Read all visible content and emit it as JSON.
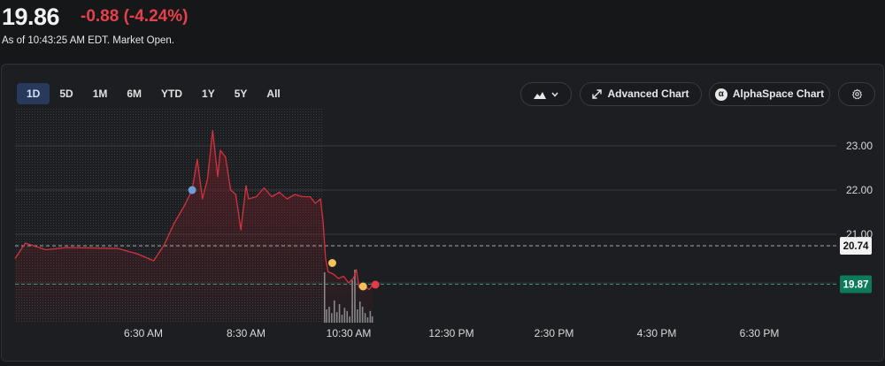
{
  "quote": {
    "price": "19.86",
    "change": "-0.88 (-4.24%)",
    "as_of": "As of 10:43:25 AM EDT. Market Open."
  },
  "toolbar": {
    "ranges": [
      "1D",
      "5D",
      "1M",
      "6M",
      "YTD",
      "1Y",
      "5Y",
      "All"
    ],
    "active_range": "1D",
    "advanced_chart_label": "Advanced Chart",
    "alphaspace_label": "AlphaSpace Chart"
  },
  "colors": {
    "down": "#e5404b",
    "line": "#d2323f",
    "current_badge": "#0d7a5c",
    "active_range_bg": "#283a5c"
  },
  "chart_data": {
    "type": "line",
    "x_ticks": [
      "6:30 AM",
      "8:30 AM",
      "10:30 AM",
      "12:30 PM",
      "2:30 PM",
      "4:30 PM",
      "6:30 PM"
    ],
    "y_ticks": [
      23.0,
      22.0,
      21.0
    ],
    "ylim": [
      19.0,
      23.8
    ],
    "reference_lines": [
      {
        "label": "20.74",
        "value": 20.74,
        "style": "dashed"
      },
      {
        "label": "19.87",
        "value": 19.87,
        "style": "dashed-green"
      }
    ],
    "series": [
      {
        "points": [
          [
            4.0,
            20.45
          ],
          [
            4.2,
            20.8
          ],
          [
            4.6,
            20.65
          ],
          [
            5.0,
            20.7
          ],
          [
            5.5,
            20.69
          ],
          [
            6.0,
            20.68
          ],
          [
            6.4,
            20.55
          ],
          [
            6.7,
            20.4
          ],
          [
            6.9,
            20.75
          ],
          [
            7.1,
            21.25
          ],
          [
            7.3,
            21.65
          ],
          [
            7.45,
            22.0
          ],
          [
            7.55,
            22.7
          ],
          [
            7.65,
            21.8
          ],
          [
            7.75,
            22.25
          ],
          [
            7.85,
            23.35
          ],
          [
            7.95,
            22.3
          ],
          [
            8.0,
            22.9
          ],
          [
            8.1,
            22.75
          ],
          [
            8.2,
            22.0
          ],
          [
            8.3,
            21.9
          ],
          [
            8.4,
            21.1
          ],
          [
            8.5,
            22.1
          ],
          [
            8.55,
            21.8
          ],
          [
            8.7,
            21.85
          ],
          [
            8.85,
            22.05
          ],
          [
            9.0,
            21.85
          ],
          [
            9.15,
            21.95
          ],
          [
            9.3,
            21.8
          ],
          [
            9.45,
            21.9
          ],
          [
            9.6,
            21.85
          ],
          [
            9.75,
            21.85
          ],
          [
            9.85,
            21.7
          ],
          [
            9.95,
            21.8
          ],
          [
            10.0,
            21.3
          ],
          [
            10.05,
            20.45
          ],
          [
            10.1,
            20.15
          ],
          [
            10.2,
            20.1
          ],
          [
            10.3,
            20.0
          ],
          [
            10.4,
            20.05
          ],
          [
            10.5,
            19.9
          ],
          [
            10.6,
            20.02
          ],
          [
            10.65,
            20.2
          ],
          [
            10.7,
            19.8
          ],
          [
            10.8,
            19.83
          ],
          [
            10.9,
            19.75
          ],
          [
            10.97,
            19.86
          ]
        ]
      }
    ],
    "markers": [
      {
        "x": 7.45,
        "y": 22.0,
        "color": "#6aa0d6"
      },
      {
        "x": 10.18,
        "y": 20.35,
        "color": "#f3c05a"
      },
      {
        "x": 10.78,
        "y": 19.82,
        "color": "#f3c05a"
      },
      {
        "x": 11.02,
        "y": 19.86,
        "color": "#e53b48"
      }
    ],
    "volume": [
      [
        10.03,
        0.95
      ],
      [
        10.07,
        0.25
      ],
      [
        10.12,
        0.3
      ],
      [
        10.17,
        0.18
      ],
      [
        10.22,
        0.42
      ],
      [
        10.27,
        0.2
      ],
      [
        10.32,
        0.35
      ],
      [
        10.37,
        0.15
      ],
      [
        10.42,
        0.28
      ],
      [
        10.47,
        0.22
      ],
      [
        10.52,
        0.12
      ],
      [
        10.57,
        0.8
      ],
      [
        10.62,
        1.0
      ],
      [
        10.67,
        0.25
      ],
      [
        10.72,
        0.4
      ],
      [
        10.77,
        0.3
      ],
      [
        10.82,
        0.18
      ],
      [
        10.87,
        0.1
      ],
      [
        10.92,
        0.22
      ],
      [
        10.96,
        0.12
      ]
    ],
    "grid": true,
    "premarket_end": 10.0
  }
}
